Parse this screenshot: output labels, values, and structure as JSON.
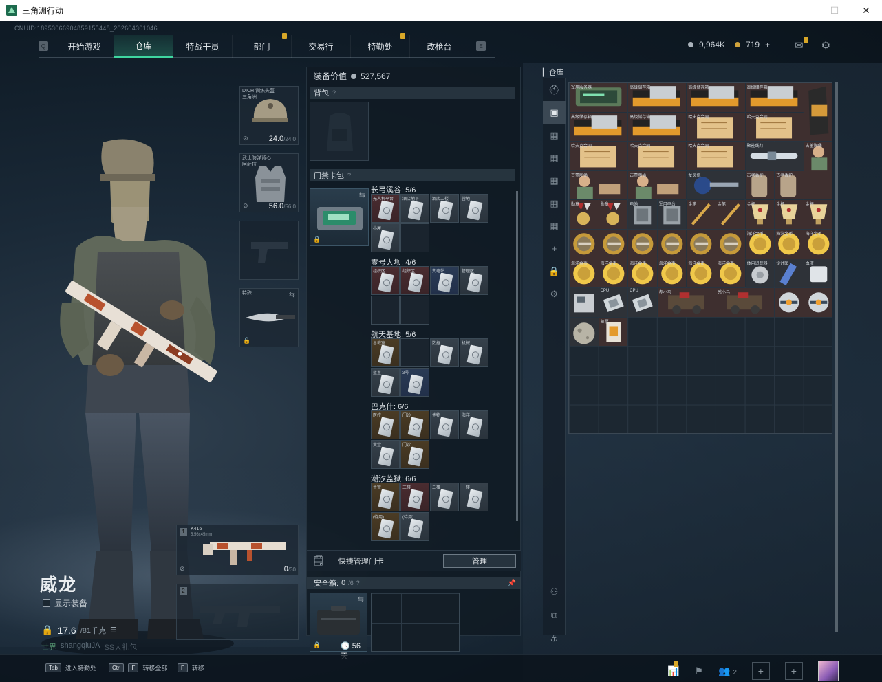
{
  "window": {
    "title": "三角洲行动",
    "minimize": "—",
    "maximize": "☐",
    "close": "✕"
  },
  "cnuid": "CNUID:18953066904859155448_202604301046",
  "nav": {
    "tabs": [
      {
        "label": "开始游戏",
        "active": false,
        "pin": false
      },
      {
        "label": "仓库",
        "active": true,
        "pin": false
      },
      {
        "label": "特战干员",
        "active": false,
        "pin": false
      },
      {
        "label": "部门",
        "active": false,
        "pin": true
      },
      {
        "label": "交易行",
        "active": false,
        "pin": false
      },
      {
        "label": "特勤处",
        "active": false,
        "pin": true
      },
      {
        "label": "改枪台",
        "active": false,
        "pin": false
      }
    ],
    "left_key": "Q",
    "right_key": "E"
  },
  "currency": {
    "silver": "9,964K",
    "gold": "719",
    "add": "+"
  },
  "operator": {
    "name": "威龙",
    "show_equipment": "显示装备",
    "weight": "17.6",
    "weight_max": "/81千克",
    "user_prefix": "世界",
    "username": "shangqiuJA",
    "gift": "SS大礼包"
  },
  "equipment": {
    "helmet": {
      "label": "DICH 训练头盔 三角洲",
      "value": "24.0",
      "max": "/24.0"
    },
    "armor": {
      "label": "武士防弹背心 阿萨拉",
      "value": "56.0",
      "max": "/56.0"
    },
    "melee": {
      "label": "特殊"
    },
    "weapon1": {
      "num": "1",
      "name": "K416",
      "caliber": "5.56x45mm",
      "ammo": "0",
      "ammo_max": "/30"
    },
    "weapon2": {
      "num": "2"
    }
  },
  "loadout": {
    "value_label": "装备价值",
    "value": "527,567",
    "backpack": "背包",
    "keycase_title": "门禁卡包",
    "maps": [
      {
        "name": "长弓溪谷: 5/6",
        "cards": [
          {
            "label": "无人机平台",
            "color": "red"
          },
          {
            "label": "酒店地下",
            "color": "grey"
          },
          {
            "label": "酒店二楼",
            "color": "grey"
          },
          {
            "label": "营地",
            "color": "grey"
          },
          {
            "label": "小屋",
            "color": "grey"
          },
          {
            "label": "",
            "color": "empty"
          }
        ]
      },
      {
        "name": "零号大坝: 4/6",
        "cards": [
          {
            "label": "组织区",
            "color": "red"
          },
          {
            "label": "组织区",
            "color": "red"
          },
          {
            "label": "变电站",
            "color": "blue"
          },
          {
            "label": "管理区",
            "color": "grey"
          },
          {
            "label": "",
            "color": "empty"
          },
          {
            "label": "",
            "color": "empty"
          }
        ]
      },
      {
        "name": "航天基地: 5/6",
        "cards": [
          {
            "label": "总裁室",
            "color": "gold"
          },
          {
            "label": "",
            "color": "empty"
          },
          {
            "label": "数据",
            "color": "grey"
          },
          {
            "label": "机械",
            "color": "grey"
          },
          {
            "label": "蓝室",
            "color": "grey"
          },
          {
            "label": "3号",
            "color": "blue"
          }
        ]
      },
      {
        "name": "巴克什: 6/6",
        "cards": [
          {
            "label": "医疗",
            "color": "gold"
          },
          {
            "label": "门诊",
            "color": "gold"
          },
          {
            "label": "博物",
            "color": "grey"
          },
          {
            "label": "海洋",
            "color": "grey"
          },
          {
            "label": "黄金",
            "color": "grey"
          },
          {
            "label": "门诊",
            "color": "gold"
          }
        ]
      },
      {
        "name": "潮汐监狱: 6/6",
        "cards": [
          {
            "label": "主管",
            "color": "gold"
          },
          {
            "label": "三楼",
            "color": "red"
          },
          {
            "label": "二楼",
            "color": "grey"
          },
          {
            "label": "一楼",
            "color": "grey"
          },
          {
            "label": "(待用)",
            "color": "gold"
          },
          {
            "label": "(待用)",
            "color": "grey"
          }
        ]
      }
    ],
    "quick_manage": "快捷管理门卡",
    "manage_button": "管理",
    "safe_title": "安全箱:",
    "safe_count": "0",
    "safe_max": "/6",
    "safe_days": "56天"
  },
  "warehouse": {
    "title": "仓库",
    "side_icons": [
      "helmet-icon",
      "camera-icon",
      "grid-icon",
      "grid-icon",
      "grid-icon",
      "grid-icon",
      "grid-icon",
      "plus-icon",
      "lock-icon",
      "gear-icon"
    ],
    "items": [
      {
        "label": "军用服务器",
        "col": 0,
        "row": 0,
        "w": 2,
        "h": 1,
        "color": "#3e2f2f",
        "art": "server"
      },
      {
        "label": "高级储存箱",
        "col": 2,
        "row": 0,
        "w": 2,
        "h": 1,
        "color": "#3e2f2f",
        "art": "box"
      },
      {
        "label": "高级储存箱",
        "col": 4,
        "row": 0,
        "w": 2,
        "h": 1,
        "color": "#3e2f2f",
        "art": "box"
      },
      {
        "label": "高级储存箱",
        "col": 6,
        "row": 0,
        "w": 2,
        "h": 1,
        "color": "#3e2f2f",
        "art": "box"
      },
      {
        "label": "",
        "col": 8,
        "row": 0,
        "w": 1,
        "h": 2,
        "color": "#3e2f2f",
        "art": "bag"
      },
      {
        "label": "高级储存箱",
        "col": 0,
        "row": 1,
        "w": 2,
        "h": 1,
        "color": "#3e2f2f",
        "art": "box"
      },
      {
        "label": "高级储存箱",
        "col": 2,
        "row": 1,
        "w": 2,
        "h": 1,
        "color": "#3e2f2f",
        "art": "box"
      },
      {
        "label": "哈夫克合同",
        "col": 4,
        "row": 1,
        "w": 2,
        "h": 1,
        "color": "#3e2f2f",
        "art": "paper"
      },
      {
        "label": "哈夫克合同",
        "col": 6,
        "row": 1,
        "w": 2,
        "h": 1,
        "color": "#3e2f2f",
        "art": "paper"
      },
      {
        "label": "哈夫克合同",
        "col": 0,
        "row": 2,
        "w": 2,
        "h": 1,
        "color": "#3e2f2f",
        "art": "paper"
      },
      {
        "label": "哈夫克合同",
        "col": 2,
        "row": 2,
        "w": 2,
        "h": 1,
        "color": "#3e2f2f",
        "art": "paper"
      },
      {
        "label": "哈夫克合同",
        "col": 4,
        "row": 2,
        "w": 2,
        "h": 1,
        "color": "#3e2f2f",
        "art": "paper"
      },
      {
        "label": "聚能线灯",
        "col": 6,
        "row": 2,
        "w": 2,
        "h": 1,
        "color": "#2e3238",
        "art": "tube"
      },
      {
        "label": "古董陶俑",
        "col": 8,
        "row": 2,
        "w": 1,
        "h": 2,
        "color": "#3e2f2f",
        "art": "statue"
      },
      {
        "label": "古董陶俑",
        "col": 0,
        "row": 3,
        "w": 2,
        "h": 1,
        "color": "#3e2f2f",
        "art": "statue"
      },
      {
        "label": "古董陶俑",
        "col": 2,
        "row": 3,
        "w": 2,
        "h": 1,
        "color": "#3e2f2f",
        "art": "statue"
      },
      {
        "label": "龙灵瓶",
        "col": 4,
        "row": 3,
        "w": 2,
        "h": 1,
        "color": "#2e3238",
        "art": "lamp"
      },
      {
        "label": "古老香炉",
        "col": 6,
        "row": 3,
        "w": 1,
        "h": 1,
        "color": "#3e2f2f",
        "art": "jar"
      },
      {
        "label": "古老香炉",
        "col": 7,
        "row": 3,
        "w": 1,
        "h": 1,
        "color": "#3e2f2f",
        "art": "jar"
      },
      {
        "label": "勋章",
        "col": 0,
        "row": 4,
        "w": 1,
        "h": 1,
        "color": "#3e2f2f",
        "art": "medal"
      },
      {
        "label": "勋章",
        "col": 1,
        "row": 4,
        "w": 1,
        "h": 1,
        "color": "#3e2f2f",
        "art": "medal"
      },
      {
        "label": "电池",
        "col": 2,
        "row": 4,
        "w": 1,
        "h": 1,
        "color": "#2e3238",
        "art": "chip"
      },
      {
        "label": "军用电台",
        "col": 3,
        "row": 4,
        "w": 1,
        "h": 1,
        "color": "#2e3238",
        "art": "chip"
      },
      {
        "label": "金笔",
        "col": 4,
        "row": 4,
        "w": 1,
        "h": 1,
        "color": "#3e2f2f",
        "art": "pen"
      },
      {
        "label": "金笔",
        "col": 5,
        "row": 4,
        "w": 1,
        "h": 1,
        "color": "#3e2f2f",
        "art": "pen"
      },
      {
        "label": "金杯",
        "col": 6,
        "row": 4,
        "w": 1,
        "h": 1,
        "color": "#3e2f2f",
        "art": "cup"
      },
      {
        "label": "金杯",
        "col": 7,
        "row": 4,
        "w": 1,
        "h": 1,
        "color": "#3e2f2f",
        "art": "cup"
      },
      {
        "label": "金杯",
        "col": 8,
        "row": 4,
        "w": 1,
        "h": 1,
        "color": "#3e2f2f",
        "art": "cup"
      },
      {
        "label": "",
        "col": 0,
        "row": 5,
        "w": 1,
        "h": 1,
        "color": "#3e2f2f",
        "art": "coin"
      },
      {
        "label": "",
        "col": 1,
        "row": 5,
        "w": 1,
        "h": 1,
        "color": "#3e2f2f",
        "art": "coin"
      },
      {
        "label": "",
        "col": 2,
        "row": 5,
        "w": 1,
        "h": 1,
        "color": "#3e2f2f",
        "art": "coin"
      },
      {
        "label": "",
        "col": 3,
        "row": 5,
        "w": 1,
        "h": 1,
        "color": "#3e2f2f",
        "art": "coin"
      },
      {
        "label": "",
        "col": 4,
        "row": 5,
        "w": 1,
        "h": 1,
        "color": "#3e2f2f",
        "art": "coin"
      },
      {
        "label": "",
        "col": 5,
        "row": 5,
        "w": 1,
        "h": 1,
        "color": "#3e2f2f",
        "art": "coin"
      },
      {
        "label": "海洋金币",
        "col": 6,
        "row": 5,
        "w": 1,
        "h": 1,
        "color": "#3e2f2f",
        "art": "goldcoin"
      },
      {
        "label": "海洋金币",
        "col": 7,
        "row": 5,
        "w": 1,
        "h": 1,
        "color": "#3e2f2f",
        "art": "goldcoin"
      },
      {
        "label": "海洋金币",
        "col": 8,
        "row": 5,
        "w": 1,
        "h": 1,
        "color": "#3e2f2f",
        "art": "goldcoin"
      },
      {
        "label": "海洋金币",
        "col": 0,
        "row": 6,
        "w": 1,
        "h": 1,
        "color": "#3e2f2f",
        "art": "goldcoin"
      },
      {
        "label": "海洋金币",
        "col": 1,
        "row": 6,
        "w": 1,
        "h": 1,
        "color": "#3e2f2f",
        "art": "goldcoin"
      },
      {
        "label": "海洋金币",
        "col": 2,
        "row": 6,
        "w": 1,
        "h": 1,
        "color": "#3e2f2f",
        "art": "goldcoin"
      },
      {
        "label": "海洋金币",
        "col": 3,
        "row": 6,
        "w": 1,
        "h": 1,
        "color": "#3e2f2f",
        "art": "goldcoin"
      },
      {
        "label": "海洋金币",
        "col": 4,
        "row": 6,
        "w": 1,
        "h": 1,
        "color": "#3e2f2f",
        "art": "goldcoin"
      },
      {
        "label": "海洋金币",
        "col": 5,
        "row": 6,
        "w": 1,
        "h": 1,
        "color": "#3e2f2f",
        "art": "goldcoin"
      },
      {
        "label": "体内追踪器",
        "col": 6,
        "row": 6,
        "w": 1,
        "h": 1,
        "color": "#2e3238",
        "art": "disc"
      },
      {
        "label": "设计图",
        "col": 7,
        "row": 6,
        "w": 1,
        "h": 1,
        "color": "#2e3238",
        "art": "vial"
      },
      {
        "label": "血液",
        "col": 8,
        "row": 6,
        "w": 1,
        "h": 1,
        "color": "#2e3238",
        "art": "box-white"
      },
      {
        "label": "",
        "col": 0,
        "row": 7,
        "w": 1,
        "h": 1,
        "color": "#2e3238",
        "art": "device"
      },
      {
        "label": "CPU",
        "col": 1,
        "row": 7,
        "w": 1,
        "h": 1,
        "color": "#2e3238",
        "art": "cpu"
      },
      {
        "label": "CPU",
        "col": 2,
        "row": 7,
        "w": 1,
        "h": 1,
        "color": "#2e3238",
        "art": "cpu"
      },
      {
        "label": "赤小马",
        "col": 3,
        "row": 7,
        "w": 2,
        "h": 1,
        "color": "#3e2f2f",
        "art": "robot"
      },
      {
        "label": "感小马",
        "col": 5,
        "row": 7,
        "w": 2,
        "h": 1,
        "color": "#3e2f2f",
        "art": "robot"
      },
      {
        "label": "",
        "col": 7,
        "row": 7,
        "w": 1,
        "h": 1,
        "color": "#3e2f2f",
        "art": "sphere"
      },
      {
        "label": "",
        "col": 8,
        "row": 7,
        "w": 1,
        "h": 1,
        "color": "#3e2f2f",
        "art": "sphere"
      },
      {
        "label": "",
        "col": 0,
        "row": 8,
        "w": 1,
        "h": 1,
        "color": "#2e3238",
        "art": "moon"
      },
      {
        "label": "邮票",
        "col": 1,
        "row": 8,
        "w": 1,
        "h": 1,
        "color": "#3e2f2f",
        "art": "stamp"
      }
    ]
  },
  "bottom": {
    "hints": [
      {
        "key": "Tab",
        "label": "进入特勤处"
      },
      {
        "key": "Ctrl",
        "key2": "F",
        "label": "转移全部"
      },
      {
        "key": "F",
        "label": "转移"
      }
    ],
    "friends": "2",
    "plus": "+"
  },
  "colors": {
    "accent": "#3fd6a0",
    "badge": "#d8a728"
  }
}
